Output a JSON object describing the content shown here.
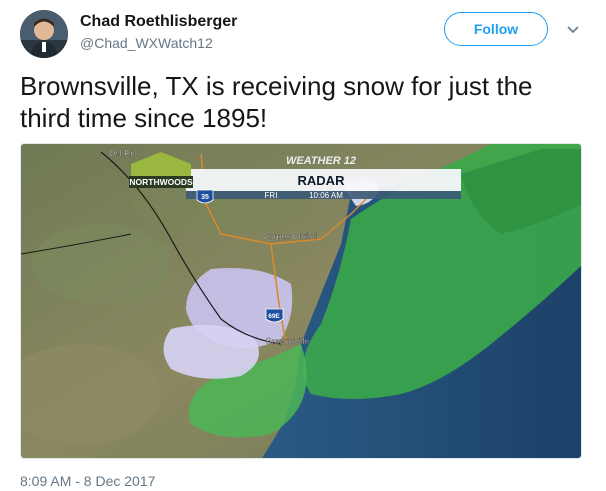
{
  "author": {
    "display_name": "Chad Roethlisberger",
    "handle": "@Chad_WXWatch12"
  },
  "follow_label": "Follow",
  "tweet": {
    "text": "Brownsville, TX is receiving snow for just the third time since 1895!",
    "timestamp": "8:09 AM - 8 Dec 2017"
  },
  "media": {
    "station_logo": "WEATHER 12",
    "product": "RADAR",
    "day": "FRI",
    "time": "10:06 AM",
    "sponsor": "NORTHWOODS",
    "cities": [
      "Del Rio",
      "Corpus Christi",
      "Brownsville"
    ],
    "highways": [
      "35",
      "69E"
    ]
  },
  "colors": {
    "accent": "#1da1f2",
    "snow": "#c9c2ee",
    "rain": "#3aa84a",
    "water": "#234e7a"
  }
}
